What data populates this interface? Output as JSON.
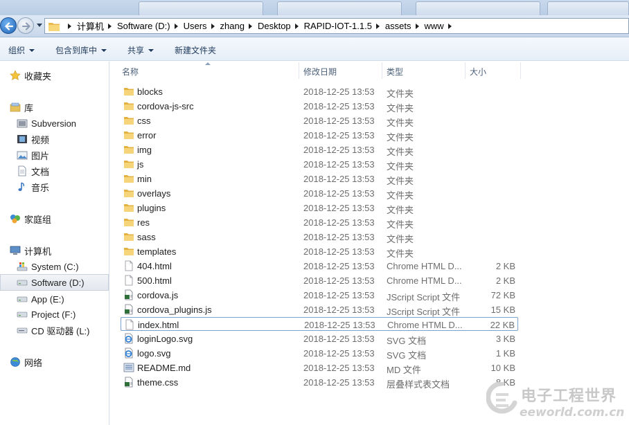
{
  "address_bar": {
    "crumbs": [
      "计算机",
      "Software (D:)",
      "Users",
      "zhang",
      "Desktop",
      "RAPID-IOT-1.1.5",
      "assets",
      "www"
    ]
  },
  "toolbar": {
    "organize": "组织",
    "include_in_library": "包含到库中",
    "share": "共享",
    "new_folder": "新建文件夹"
  },
  "nav": {
    "favorites": "收藏夹",
    "libraries": "库",
    "lib_items": [
      "Subversion",
      "视频",
      "图片",
      "文档",
      "音乐"
    ],
    "homegroup": "家庭组",
    "computer": "计算机",
    "drives": [
      "System (C:)",
      "Software (D:)",
      "App (E:)",
      "Project (F:)",
      "CD 驱动器 (L:)"
    ],
    "network": "网络"
  },
  "columns": {
    "name": "名称",
    "date": "修改日期",
    "type": "类型",
    "size": "大小"
  },
  "files": [
    {
      "name": "blocks",
      "date": "2018-12-25 13:53",
      "type": "文件夹",
      "size": "",
      "icon": "folder-icon"
    },
    {
      "name": "cordova-js-src",
      "date": "2018-12-25 13:53",
      "type": "文件夹",
      "size": "",
      "icon": "folder-icon"
    },
    {
      "name": "css",
      "date": "2018-12-25 13:53",
      "type": "文件夹",
      "size": "",
      "icon": "folder-icon"
    },
    {
      "name": "error",
      "date": "2018-12-25 13:53",
      "type": "文件夹",
      "size": "",
      "icon": "folder-icon"
    },
    {
      "name": "img",
      "date": "2018-12-25 13:53",
      "type": "文件夹",
      "size": "",
      "icon": "folder-icon"
    },
    {
      "name": "js",
      "date": "2018-12-25 13:53",
      "type": "文件夹",
      "size": "",
      "icon": "folder-icon"
    },
    {
      "name": "min",
      "date": "2018-12-25 13:53",
      "type": "文件夹",
      "size": "",
      "icon": "folder-icon"
    },
    {
      "name": "overlays",
      "date": "2018-12-25 13:53",
      "type": "文件夹",
      "size": "",
      "icon": "folder-icon"
    },
    {
      "name": "plugins",
      "date": "2018-12-25 13:53",
      "type": "文件夹",
      "size": "",
      "icon": "folder-icon"
    },
    {
      "name": "res",
      "date": "2018-12-25 13:53",
      "type": "文件夹",
      "size": "",
      "icon": "folder-icon"
    },
    {
      "name": "sass",
      "date": "2018-12-25 13:53",
      "type": "文件夹",
      "size": "",
      "icon": "folder-icon"
    },
    {
      "name": "templates",
      "date": "2018-12-25 13:53",
      "type": "文件夹",
      "size": "",
      "icon": "folder-icon"
    },
    {
      "name": "404.html",
      "date": "2018-12-25 13:53",
      "type": "Chrome HTML D...",
      "size": "2 KB",
      "icon": "html-file-icon"
    },
    {
      "name": "500.html",
      "date": "2018-12-25 13:53",
      "type": "Chrome HTML D...",
      "size": "2 KB",
      "icon": "html-file-icon"
    },
    {
      "name": "cordova.js",
      "date": "2018-12-25 13:53",
      "type": "JScript Script 文件",
      "size": "72 KB",
      "icon": "script-file-icon"
    },
    {
      "name": "cordova_plugins.js",
      "date": "2018-12-25 13:53",
      "type": "JScript Script 文件",
      "size": "15 KB",
      "icon": "script-file-icon"
    },
    {
      "name": "index.html",
      "date": "2018-12-25 13:53",
      "type": "Chrome HTML D...",
      "size": "22 KB",
      "icon": "html-file-icon"
    },
    {
      "name": "loginLogo.svg",
      "date": "2018-12-25 13:53",
      "type": "SVG 文档",
      "size": "3 KB",
      "icon": "ie-file-icon"
    },
    {
      "name": "logo.svg",
      "date": "2018-12-25 13:53",
      "type": "SVG 文档",
      "size": "1 KB",
      "icon": "ie-file-icon"
    },
    {
      "name": "README.md",
      "date": "2018-12-25 13:53",
      "type": "MD 文件",
      "size": "10 KB",
      "icon": "md-file-icon"
    },
    {
      "name": "theme.css",
      "date": "2018-12-25 13:53",
      "type": "层叠样式表文档",
      "size": "8 KB",
      "icon": "css-file-icon"
    }
  ],
  "focused_row": "index.html",
  "watermark": {
    "title": "电子工程世界",
    "url": "eeworld.com.cn"
  }
}
